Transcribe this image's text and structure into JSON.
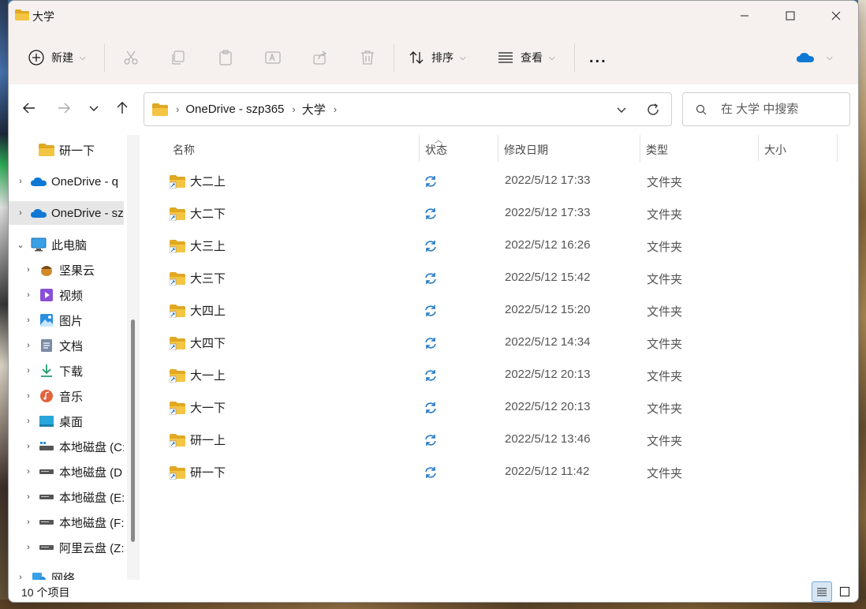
{
  "window": {
    "title": "大学",
    "controls": {
      "minimize": "minimize",
      "maximize": "maximize",
      "close": "close"
    }
  },
  "toolbar": {
    "new_label": "新建",
    "sort_label": "排序",
    "view_label": "查看",
    "more_label": "..."
  },
  "address": {
    "crumbs": [
      "OneDrive - szp365",
      "大学"
    ]
  },
  "search": {
    "placeholder": "在 大学 中搜索"
  },
  "sidebar": {
    "items": [
      {
        "label": "研一下",
        "icon": "folder-icon"
      },
      {
        "label": "OneDrive - q",
        "icon": "cloud-icon"
      },
      {
        "label": "OneDrive - sz",
        "icon": "cloud-icon"
      },
      {
        "label": "此电脑",
        "icon": "computer-icon"
      },
      {
        "label": "坚果云",
        "icon": "nut-icon"
      },
      {
        "label": "视频",
        "icon": "video-icon"
      },
      {
        "label": "图片",
        "icon": "picture-icon"
      },
      {
        "label": "文档",
        "icon": "document-icon"
      },
      {
        "label": "下载",
        "icon": "download-icon"
      },
      {
        "label": "音乐",
        "icon": "music-icon"
      },
      {
        "label": "桌面",
        "icon": "desktop-icon"
      },
      {
        "label": "本地磁盘 (C:",
        "icon": "drive-icon"
      },
      {
        "label": "本地磁盘 (D",
        "icon": "drive-icon"
      },
      {
        "label": "本地磁盘 (E:",
        "icon": "drive-icon"
      },
      {
        "label": "本地磁盘 (F:",
        "icon": "drive-icon"
      },
      {
        "label": "阿里云盘 (Z:",
        "icon": "drive-icon"
      },
      {
        "label": "网络",
        "icon": "network-icon"
      }
    ]
  },
  "columns": {
    "name": "名称",
    "status": "状态",
    "modified": "修改日期",
    "type": "类型",
    "size": "大小"
  },
  "files": [
    {
      "name": "大二上",
      "modified": "2022/5/12 17:33",
      "type": "文件夹"
    },
    {
      "name": "大二下",
      "modified": "2022/5/12 17:33",
      "type": "文件夹"
    },
    {
      "name": "大三上",
      "modified": "2022/5/12 16:26",
      "type": "文件夹"
    },
    {
      "name": "大三下",
      "modified": "2022/5/12 15:42",
      "type": "文件夹"
    },
    {
      "name": "大四上",
      "modified": "2022/5/12 15:20",
      "type": "文件夹"
    },
    {
      "name": "大四下",
      "modified": "2022/5/12 14:34",
      "type": "文件夹"
    },
    {
      "name": "大一上",
      "modified": "2022/5/12 20:13",
      "type": "文件夹"
    },
    {
      "name": "大一下",
      "modified": "2022/5/12 20:13",
      "type": "文件夹"
    },
    {
      "name": "研一上",
      "modified": "2022/5/12 13:46",
      "type": "文件夹"
    },
    {
      "name": "研一下",
      "modified": "2022/5/12 11:42",
      "type": "文件夹"
    }
  ],
  "statusbar": {
    "count": "10 个项目"
  },
  "colors": {
    "folder": "#f4c542",
    "folder_dark": "#e0a823",
    "sync_blue": "#1a73c8",
    "onedrive_blue": "#0f78d4",
    "title_band": "#f6f1ef"
  }
}
